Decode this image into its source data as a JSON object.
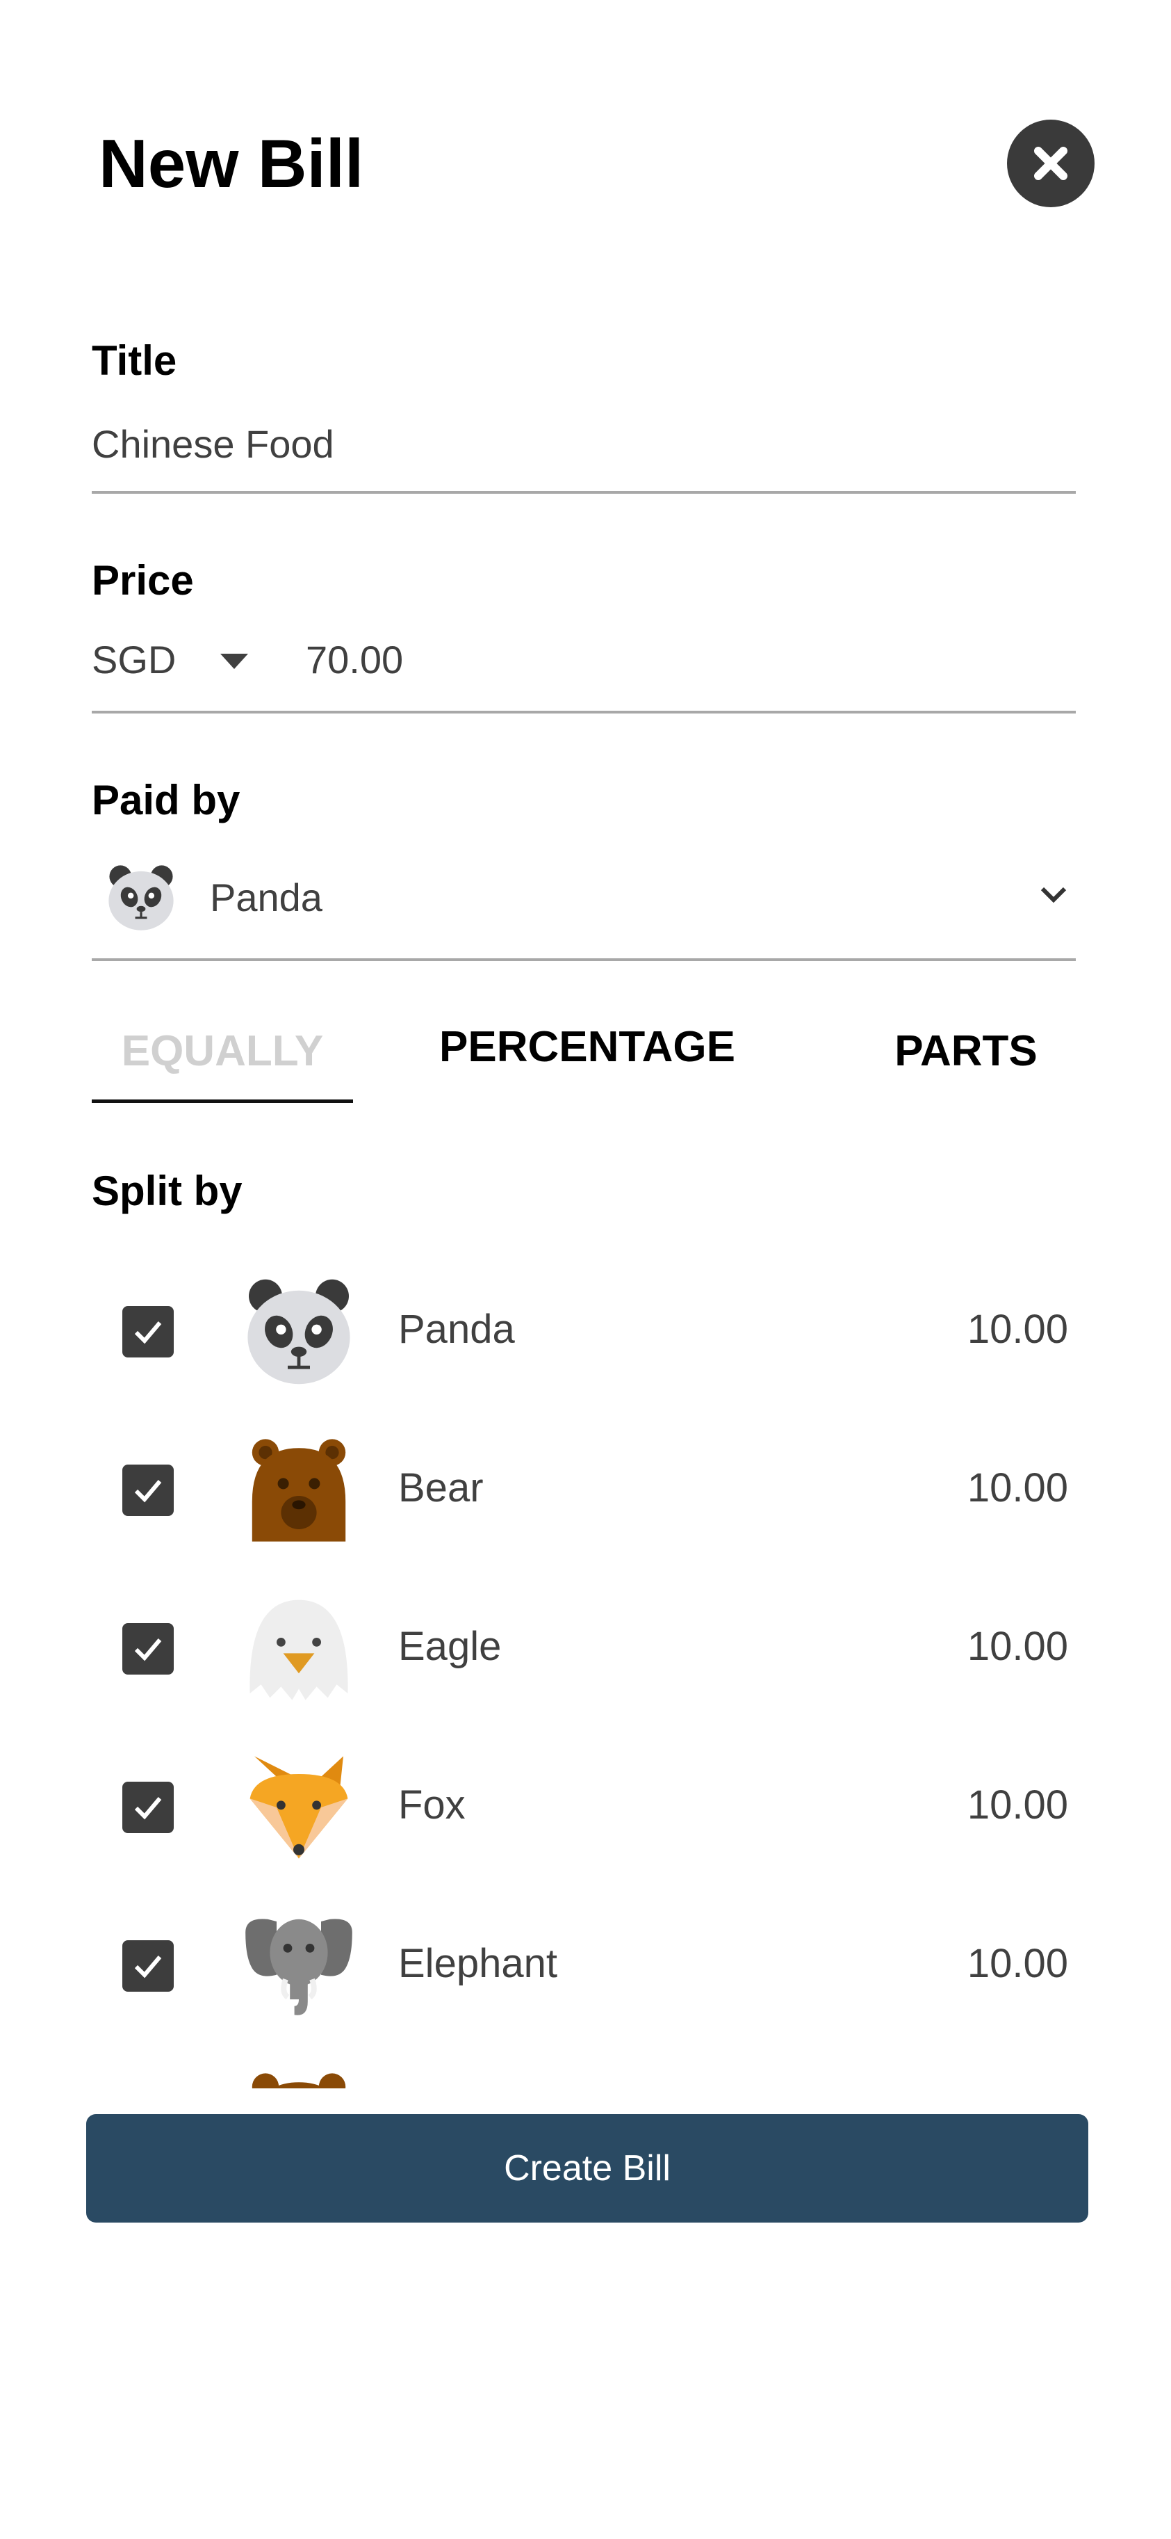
{
  "header": {
    "title": "New Bill"
  },
  "title_field": {
    "label": "Title",
    "value": "Chinese Food"
  },
  "price_field": {
    "label": "Price",
    "currency": "SGD",
    "amount": "70.00"
  },
  "paid_by": {
    "label": "Paid by",
    "name": "Panda",
    "avatar": "panda-icon"
  },
  "tabs": [
    {
      "label": "EQUALLY",
      "selected": true
    },
    {
      "label": "PERCENTAGE",
      "selected": false
    },
    {
      "label": "PARTS",
      "selected": false
    }
  ],
  "split": {
    "label": "Split by",
    "rows": [
      {
        "name": "Panda",
        "amount": "10.00",
        "checked": true,
        "avatar": "panda-icon"
      },
      {
        "name": "Bear",
        "amount": "10.00",
        "checked": true,
        "avatar": "bear-icon"
      },
      {
        "name": "Eagle",
        "amount": "10.00",
        "checked": true,
        "avatar": "eagle-icon"
      },
      {
        "name": "Fox",
        "amount": "10.00",
        "checked": true,
        "avatar": "fox-icon"
      },
      {
        "name": "Elephant",
        "amount": "10.00",
        "checked": true,
        "avatar": "elephant-icon"
      }
    ]
  },
  "actions": {
    "create_label": "Create Bill"
  },
  "colors": {
    "primary_button": "#2a4a63",
    "checkbox": "#3d3d3d",
    "tab_inactive": "#d0d0d0"
  }
}
